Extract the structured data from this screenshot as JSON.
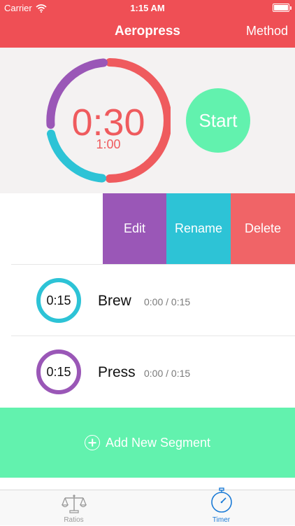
{
  "status": {
    "carrier": "Carrier",
    "time": "1:15 AM"
  },
  "nav": {
    "title": "Aeropress",
    "right_button": "Method"
  },
  "timer": {
    "main": "0:30",
    "sub": "1:00",
    "start_label": "Start",
    "ring_colors": [
      "#9a57b7",
      "#ef5b5e",
      "#2dc3d6"
    ]
  },
  "actions": {
    "edit": "Edit",
    "rename": "Rename",
    "delete": "Delete"
  },
  "segments": [
    {
      "time": "0:15",
      "name": "Brew",
      "progress": "0:00 / 0:15",
      "color": "#2dc3d6"
    },
    {
      "time": "0:15",
      "name": "Press",
      "progress": "0:00 / 0:15",
      "color": "#9a57b7"
    }
  ],
  "add_segment": {
    "label": "Add New Segment",
    "icon": "plus-circle-icon"
  },
  "tabbar": {
    "items": [
      {
        "label": "Ratios",
        "icon": "scale-icon",
        "active": false
      },
      {
        "label": "Timer",
        "icon": "stopwatch-icon",
        "active": true
      }
    ]
  }
}
